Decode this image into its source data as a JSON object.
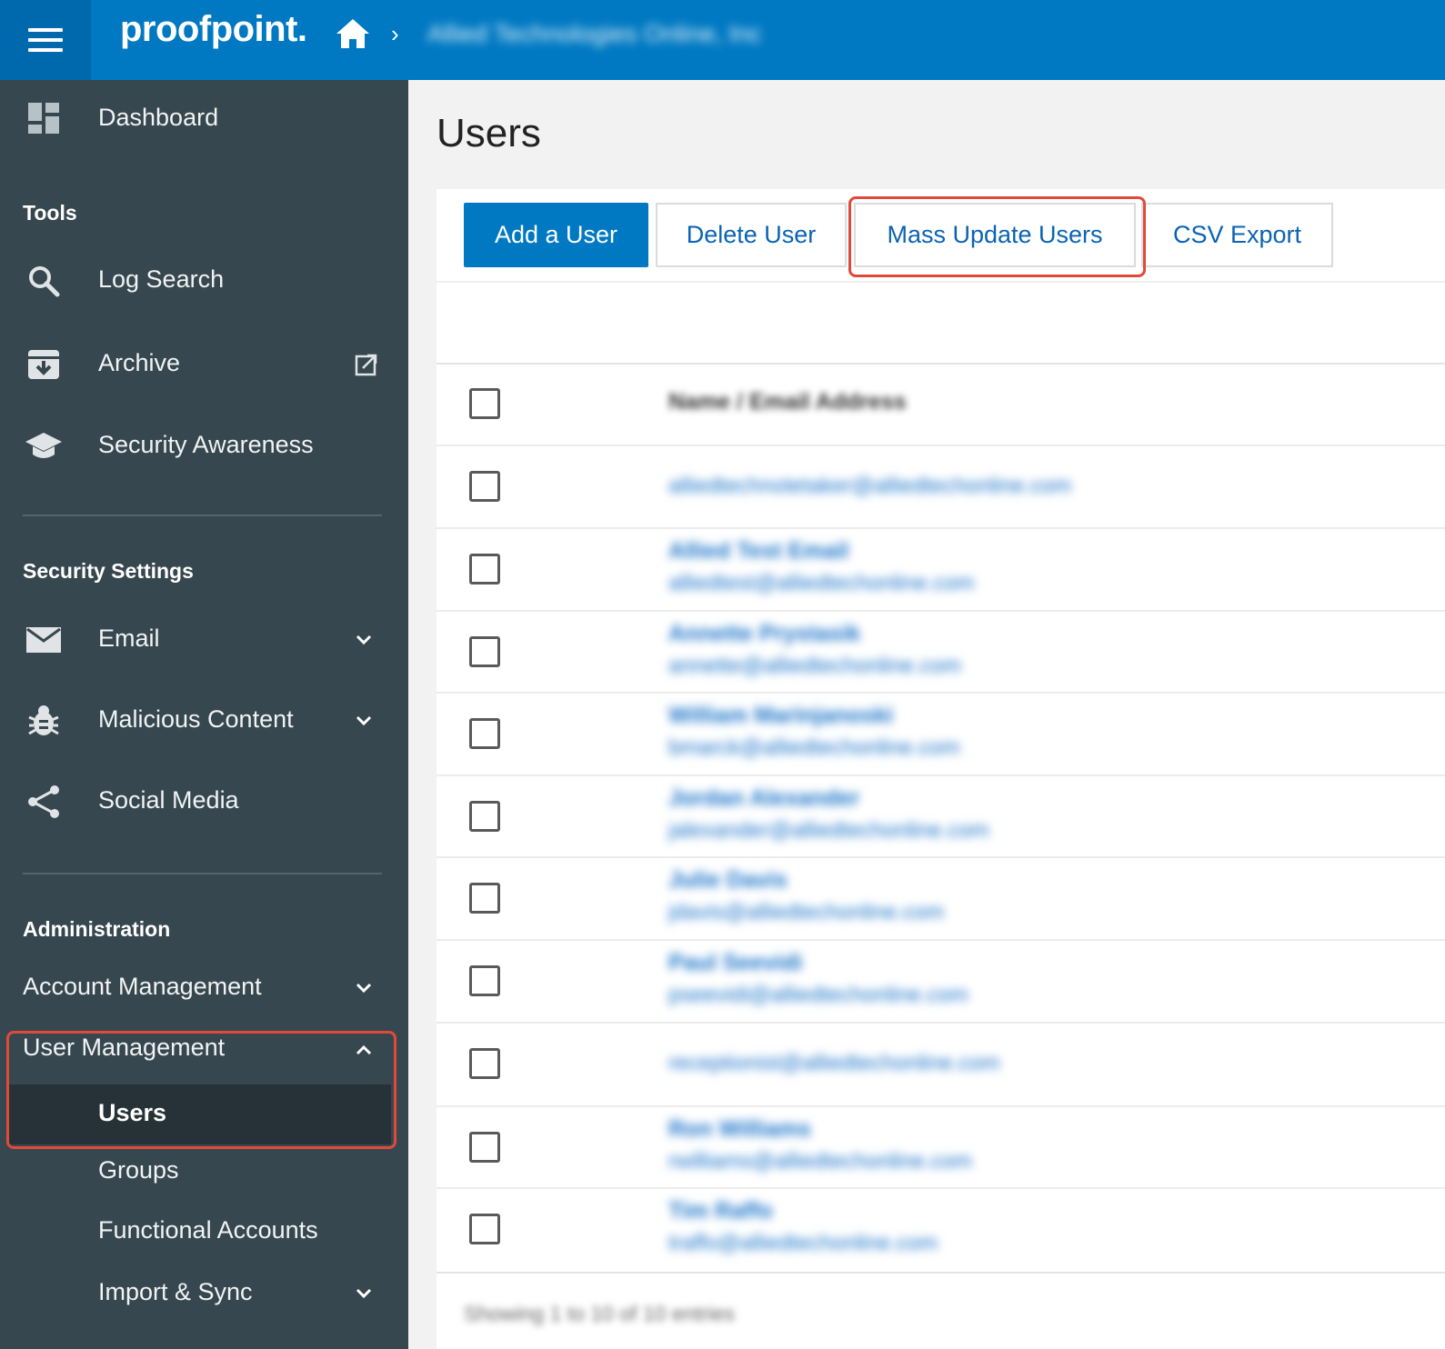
{
  "header": {
    "logo": "proofpoint.",
    "breadcrumb_separator": "›",
    "organization": "Allied Technologies Online, Inc"
  },
  "sidebar": {
    "dashboard": "Dashboard",
    "tools_title": "Tools",
    "log_search": "Log Search",
    "archive": "Archive",
    "security_awareness": "Security Awareness",
    "security_settings_title": "Security Settings",
    "email": "Email",
    "malicious_content": "Malicious Content",
    "social_media": "Social Media",
    "administration_title": "Administration",
    "account_management": "Account Management",
    "user_management": "User Management",
    "users": "Users",
    "groups": "Groups",
    "functional_accounts": "Functional Accounts",
    "import_sync": "Import & Sync"
  },
  "main": {
    "title": "Users",
    "buttons": {
      "add_user": "Add a User",
      "delete_user": "Delete User",
      "mass_update": "Mass Update Users",
      "csv_export": "CSV Export"
    },
    "column_header": "Name / Email Address",
    "rows": [
      {
        "name": "",
        "email": "alliedtechnotetaker@alliedtechonline.com"
      },
      {
        "name": "Allied Test Email",
        "email": "alliedtest@alliedtechonline.com"
      },
      {
        "name": "Annette Prystasik",
        "email": "annette@alliedtechonline.com"
      },
      {
        "name": "William Marinjanoski",
        "email": "bmarck@alliedtechonline.com"
      },
      {
        "name": "Jordan Alexander",
        "email": "jalexander@alliedtechonline.com"
      },
      {
        "name": "Julie Davis",
        "email": "jdavis@alliedtechonline.com"
      },
      {
        "name": "Paul Seevidi",
        "email": "pseevidi@alliedtechonline.com"
      },
      {
        "name": "",
        "email": "receptionist@alliedtechonline.com"
      },
      {
        "name": "Ron Williams",
        "email": "rwilliams@alliedtechonline.com"
      },
      {
        "name": "Tim Raffo",
        "email": "traffo@alliedtechonline.com"
      }
    ],
    "footer_info": "Showing 1 to 10 of 10 entries"
  },
  "colors": {
    "topbar": "#0079c2",
    "sidebar": "#37474f",
    "highlight": "#e04a3a",
    "link": "#1a73c9"
  }
}
